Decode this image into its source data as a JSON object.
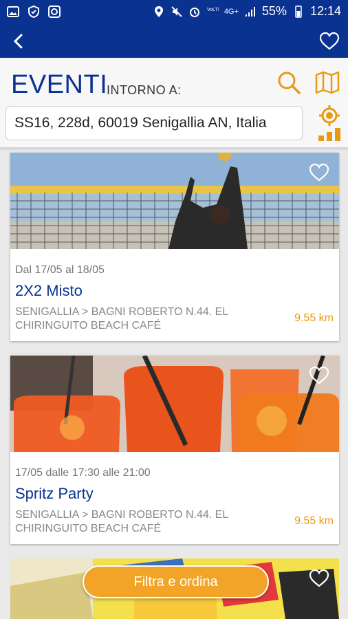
{
  "status_bar": {
    "battery": "55%",
    "time": "12:14",
    "network": "4G+"
  },
  "header": {
    "title": "EVENTI",
    "subtitle": "INTORNO A:",
    "location_value": "SS16, 228d, 60019 Senigallia AN, Italia"
  },
  "events": [
    {
      "date": "Dal 17/05 al 18/05",
      "name": "2X2 Misto",
      "place": "SENIGALLIA > BAGNI ROBERTO N.44. EL CHIRINGUITO BEACH CAFÉ",
      "distance": "9.55 km"
    },
    {
      "date": "17/05 dalle 17:30 alle 21:00",
      "name": "Spritz Party",
      "place": "SENIGALLIA > BAGNI ROBERTO N.44. EL CHIRINGUITO BEACH CAFÉ",
      "distance": "9.55 km"
    }
  ],
  "filter_button": "Filtra e ordina",
  "colors": {
    "primary": "#0a3291",
    "accent": "#f2a428",
    "background": "#e9e9ea"
  },
  "icons": [
    "back-arrow-icon",
    "heart-icon",
    "search-icon",
    "map-icon",
    "gps-target-icon",
    "signal-bars-icon"
  ]
}
